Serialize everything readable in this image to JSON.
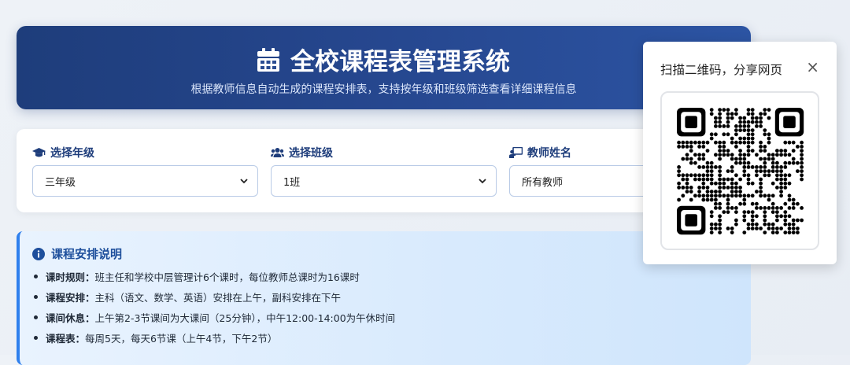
{
  "header": {
    "title": "全校课程表管理系统",
    "subtitle": "根据教师信息自动生成的课程安排表，支持按年级和班级筛选查看详细课程信息",
    "icon": "calendar-icon"
  },
  "filters": [
    {
      "label": "选择年级",
      "icon": "graduation-cap-icon",
      "value": "三年级"
    },
    {
      "label": "选择班级",
      "icon": "users-icon",
      "value": "1班"
    },
    {
      "label": "教师姓名",
      "icon": "chalkboard-teacher-icon",
      "value": "所有教师"
    }
  ],
  "info": {
    "title": "课程安排说明",
    "icon": "info-circle-icon",
    "items": [
      {
        "label": "课时规则：",
        "text": "班主任和学校中层管理计6个课时，每位教师总课时为16课时"
      },
      {
        "label": "课程安排：",
        "text": "主科（语文、数学、英语）安排在上午，副科安排在下午"
      },
      {
        "label": "课间休息：",
        "text": "上午第2-3节课间为大课间（25分钟），中午12:00-14:00为午休时间"
      },
      {
        "label": "课程表：",
        "text": "每周5天，每天6节课（上午4节，下午2节）"
      }
    ]
  },
  "qr": {
    "title": "扫描二维码，分享网页",
    "close": "×"
  },
  "colors": {
    "header_start": "#1e3d7b",
    "header_end": "#2c54a3",
    "accent": "#2f80ed",
    "label": "#1e3d7b"
  }
}
